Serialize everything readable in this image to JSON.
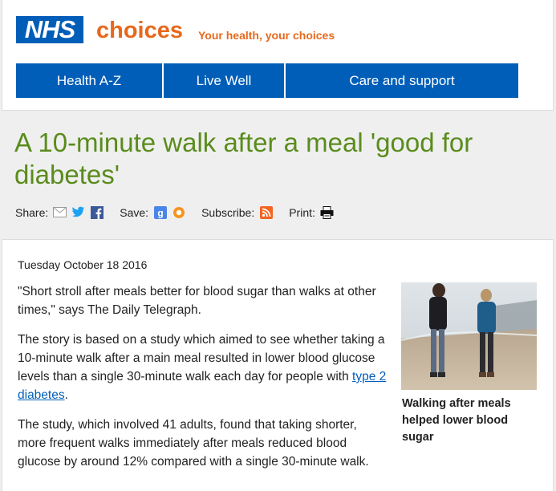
{
  "header": {
    "logo": "NHS",
    "brand": "choices",
    "tagline": "Your health, your choices",
    "nav": [
      {
        "label": "Health A-Z"
      },
      {
        "label": "Live Well"
      },
      {
        "label": "Care and support"
      }
    ]
  },
  "article": {
    "title": "A 10-minute walk after a meal 'good for diabetes'",
    "share": {
      "share_label": "Share:",
      "save_label": "Save:",
      "subscribe_label": "Subscribe:",
      "print_label": "Print:"
    },
    "date": "Tuesday October 18 2016",
    "paragraphs": [
      "\"Short stroll after meals better for blood sugar than walks at other times,\" says The Daily Telegraph.",
      "The story is based on a study which aimed to see whether taking a 10-minute walk after a main meal resulted in lower blood glucose levels than a single 30-minute walk each day for people with ",
      "The study, which involved 41 adults, found that taking shorter, more frequent walks immediately after meals reduced blood glucose by around 12% compared with a single 30-minute walk."
    ],
    "link_text": "type 2 diabetes",
    "link_suffix": ".",
    "image_caption": "Walking after meals helped lower blood sugar"
  },
  "colors": {
    "nhs_blue": "#005eb8",
    "choices_orange": "#e8681b",
    "title_green": "#5a8c1c"
  },
  "icons": [
    "email-icon",
    "twitter-icon",
    "facebook-icon",
    "google-icon",
    "delicious-icon",
    "rss-icon",
    "printer-icon"
  ]
}
